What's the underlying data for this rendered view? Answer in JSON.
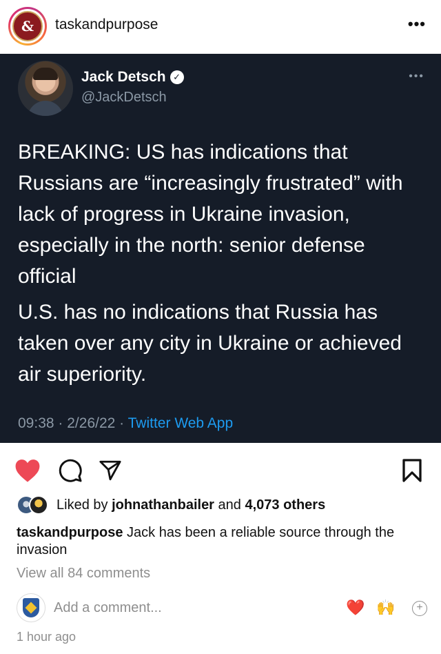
{
  "post": {
    "username": "taskandpurpose",
    "avatar_glyph": "&",
    "more_label": "•••"
  },
  "tweet": {
    "name": "Jack Detsch",
    "verified_glyph": "✓",
    "handle": "@JackDetsch",
    "more_label": "•••",
    "paragraph_1": "BREAKING: US has indications that Russians are “increasingly frustrated” with lack of progress in Ukraine invasion, especially in the north: senior defense official",
    "paragraph_2": "U.S. has no indications that Russia has taken over any city in Ukraine or achieved air superiority.",
    "time": "09:38",
    "date": "2/26/22",
    "separator": "·",
    "source": "Twitter Web App"
  },
  "actions": {
    "heart_icon": "heart-icon",
    "comment_icon": "comment-icon",
    "share_icon": "share-icon",
    "save_icon": "bookmark-icon",
    "liked_color": "#ed4956"
  },
  "likes": {
    "prefix": "Liked by",
    "user": "johnathanbailer",
    "joiner": "and",
    "others": "4,073 others"
  },
  "caption": {
    "user": "taskandpurpose",
    "text": "Jack has been a reliable source through the invasion"
  },
  "comments": {
    "view_all": "View all 84 comments"
  },
  "add_comment": {
    "placeholder": "Add a comment...",
    "quick_heart": "❤️",
    "quick_hands": "🙌",
    "plus": "+"
  },
  "timestamp": "1 hour ago"
}
